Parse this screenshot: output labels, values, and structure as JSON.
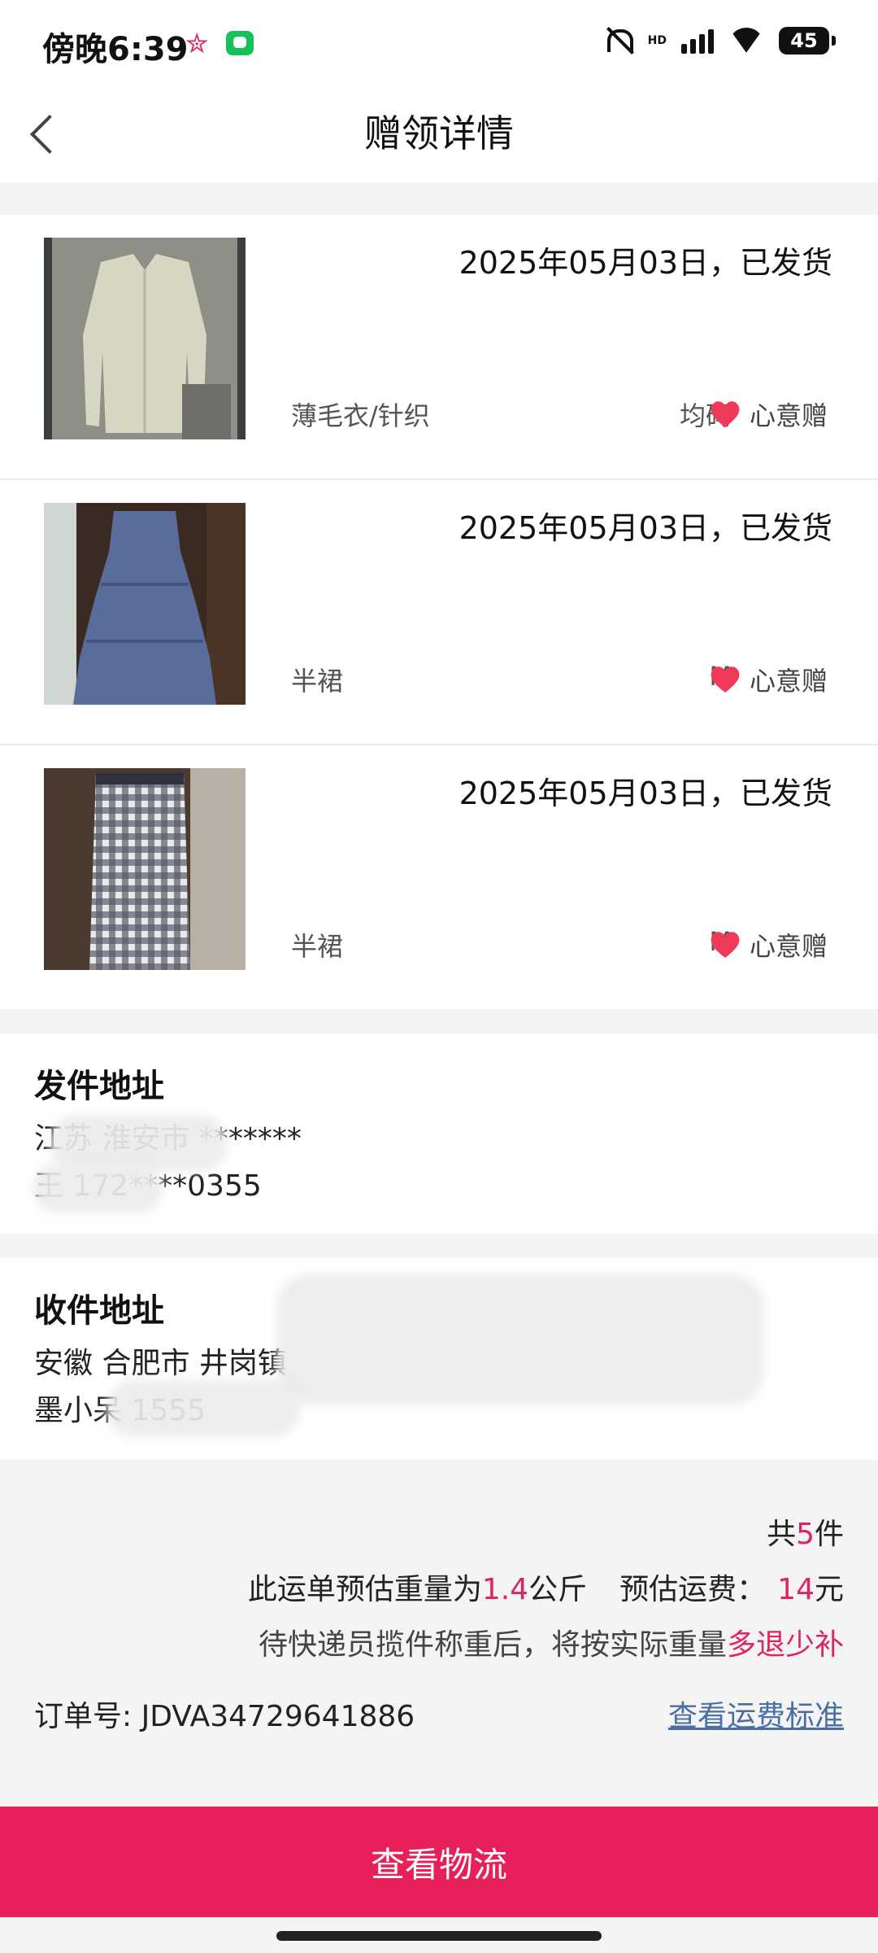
{
  "status_bar": {
    "time": "傍晚6:39",
    "hd_label": "HD",
    "battery": "45"
  },
  "nav": {
    "title": "赠领详情"
  },
  "items": [
    {
      "status": "2025年05月03日，已发货",
      "category": "薄毛衣/针织",
      "size": "均码",
      "gift_label": "心意赠"
    },
    {
      "status": "2025年05月03日，已发货",
      "category": "半裙",
      "size": "M",
      "gift_label": "心意赠"
    },
    {
      "status": "2025年05月03日，已发货",
      "category": "半裙",
      "size": "M",
      "gift_label": "心意赠"
    }
  ],
  "sender": {
    "title": "发件地址",
    "line1": "江苏 淮安市 *******",
    "line2": "王 172****0355"
  },
  "receiver": {
    "title": "收件地址",
    "line1": "安徽 合肥市 井岗镇",
    "line2": "墨小呆 1555"
  },
  "summary": {
    "count_prefix": "共",
    "count": "5",
    "count_suffix": "件",
    "weight_prefix": "此运单预估重量为",
    "weight": "1.4",
    "weight_unit": "公斤",
    "fee_prefix": "预估运费：",
    "fee": "14",
    "fee_unit": "元",
    "note_prefix": "待快递员揽件称重后，将按实际重量",
    "note_accent": "多退少补"
  },
  "order": {
    "label": "订单号:",
    "number": "JDVA34729641886",
    "fee_standard_link": "查看运费标准"
  },
  "cta": {
    "label": "查看物流"
  },
  "colors": {
    "accent": "#e0245e",
    "cta_bg": "#e8205a",
    "link": "#4a6fa5"
  }
}
